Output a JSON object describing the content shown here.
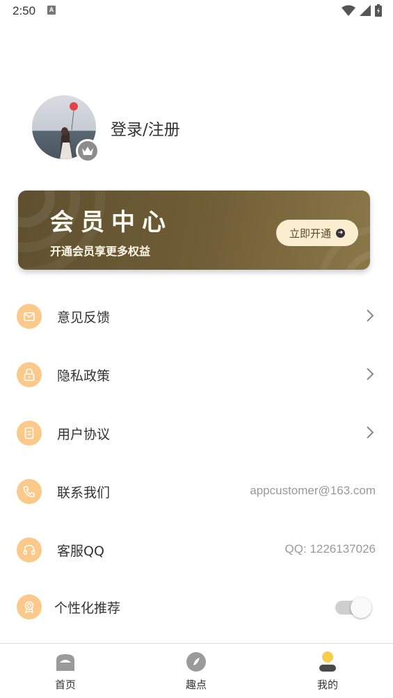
{
  "status_bar": {
    "time": "2:50",
    "notification_icon": "a-box-icon",
    "icons": [
      "wifi-icon",
      "signal-icon",
      "battery-icon"
    ]
  },
  "profile": {
    "login_label": "登录/注册",
    "avatar_icon": "avatar-image",
    "badge_icon": "crown-icon"
  },
  "vip_card": {
    "title": "会员中心",
    "subtitle": "开通会员享更多权益",
    "button_label": "立即开通",
    "button_icon": "arrow-right-circle-icon"
  },
  "menu": [
    {
      "label": "意见反馈",
      "icon": "feedback-icon",
      "chevron": true
    },
    {
      "label": "隐私政策",
      "icon": "lock-icon",
      "chevron": true
    },
    {
      "label": "用户协议",
      "icon": "document-icon",
      "chevron": true
    },
    {
      "label": "联系我们",
      "icon": "phone-icon",
      "value": "appcustomer@163.com"
    },
    {
      "label": "客服QQ",
      "icon": "headset-icon",
      "value": "QQ: 1226137026"
    },
    {
      "label": "个性化推荐",
      "icon": "badge-icon",
      "toggle": true,
      "toggle_on": false
    }
  ],
  "tabs": [
    {
      "label": "首页",
      "icon": "home-icon",
      "active": false
    },
    {
      "label": "趣点",
      "icon": "compass-icon",
      "active": false
    },
    {
      "label": "我的",
      "icon": "user-icon",
      "active": true
    }
  ],
  "colors": {
    "accent": "#fbc98a",
    "vip_card": "#6e5c35",
    "vip_button": "#fbeed0",
    "active_tab": "#f6cf4a"
  }
}
